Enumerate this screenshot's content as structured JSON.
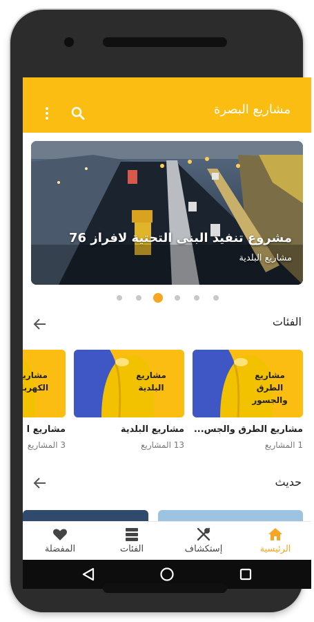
{
  "app_bar": {
    "title": "مشاريع البصرة",
    "search_icon": "search-icon",
    "more_icon": "more-vert-icon",
    "color": "#fbbd12"
  },
  "banner": {
    "title": "مشروع تنفيذ البنى التحتية لافراز 76",
    "subtitle": "مشاريع البلدية",
    "dots": {
      "count": 6,
      "active_index": 2
    }
  },
  "categories": {
    "title": "الفئات",
    "arrow_icon": "arrow-left-icon",
    "items": [
      {
        "image_text_line1": "مشاريع",
        "image_text_line2": "الطرق والجسور",
        "name": "مشاريع الطرق والجس...",
        "count": "1 المشاريع"
      },
      {
        "image_text_line1": "مشاريع",
        "image_text_line2": "البلدية",
        "name": "مشاريع البلدية",
        "count": "13 المشاريع"
      },
      {
        "image_text_line1": "مشاريع",
        "image_text_line2": "الكهرباء",
        "name": "مشاريع ا",
        "count": "3 المشاريع"
      }
    ]
  },
  "recent": {
    "title": "حديث",
    "arrow_icon": "arrow-left-icon"
  },
  "bottom_nav": {
    "items": [
      {
        "label": "الرئيسية",
        "icon": "home-icon",
        "active": true
      },
      {
        "label": "إستكشاف",
        "icon": "explore-icon",
        "active": false
      },
      {
        "label": "الفئات",
        "icon": "categories-icon",
        "active": false
      },
      {
        "label": "المفضلة",
        "icon": "favorite-icon",
        "active": false
      }
    ],
    "active_color": "#f5a623"
  },
  "system_nav": {
    "icons": [
      "back-icon",
      "home-circle-icon",
      "recents-icon"
    ]
  }
}
